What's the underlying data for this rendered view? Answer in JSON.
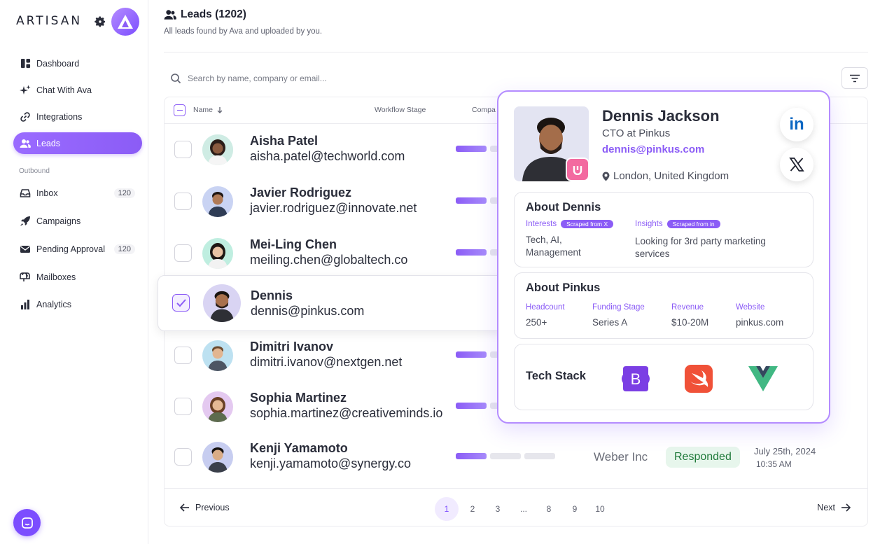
{
  "brand": {
    "name": "ARTISAN"
  },
  "sidebar": {
    "items": [
      {
        "label": "Dashboard",
        "icon": "dashboard-icon"
      },
      {
        "label": "Chat With Ava",
        "icon": "sparkle-icon"
      },
      {
        "label": "Integrations",
        "icon": "link-icon"
      },
      {
        "label": "Leads",
        "icon": "users-icon",
        "active": true
      }
    ],
    "section_label": "Outbound",
    "outbound_items": [
      {
        "label": "Inbox",
        "icon": "inbox-icon",
        "count": "120"
      },
      {
        "label": "Campaigns",
        "icon": "rocket-icon"
      },
      {
        "label": "Pending Approval",
        "icon": "mail-icon",
        "count": "120"
      },
      {
        "label": "Mailboxes",
        "icon": "mailbox-icon"
      },
      {
        "label": "Analytics",
        "icon": "bar-chart-icon"
      }
    ]
  },
  "header": {
    "title": "Leads (1202)",
    "subtitle": "All leads found by Ava and uploaded by you."
  },
  "search": {
    "placeholder": "Search by name, company or email..."
  },
  "table": {
    "columns": {
      "name": "Name",
      "stage": "Workflow Stage",
      "company": "Compa"
    },
    "rows": [
      {
        "name": "Aisha Patel",
        "email": "aisha.patel@techworld.com",
        "stage": 1,
        "checked": false
      },
      {
        "name": "Javier Rodriguez",
        "email": "javier.rodriguez@innovate.net",
        "stage": 1,
        "checked": false
      },
      {
        "name": "Mei-Ling Chen",
        "email": "meiling.chen@globaltech.co",
        "stage": 1,
        "checked": false
      },
      {
        "name": "Dennis",
        "email": "dennis@pinkus.com",
        "stage": 0,
        "checked": true
      },
      {
        "name": "Dimitri Ivanov",
        "email": "dimitri.ivanov@nextgen.net",
        "stage": 1,
        "checked": false
      },
      {
        "name": "Sophia Martinez",
        "email": "sophia.martinez@creativeminds.io",
        "stage": 1,
        "checked": false
      },
      {
        "name": "Kenji Yamamoto",
        "email": "kenji.yamamoto@synergy.co",
        "stage": 1,
        "checked": false,
        "company": "Weber Inc",
        "status": "Responded",
        "date": "July 25th, 2024",
        "time": "10:35 AM"
      }
    ]
  },
  "pagination": {
    "prev": "Previous",
    "next": "Next",
    "pages": [
      "1",
      "2",
      "3",
      "...",
      "8",
      "9",
      "10"
    ],
    "current": "1"
  },
  "profile": {
    "name": "Dennis Jackson",
    "role": "CTO at Pinkus",
    "email": "dennis@pinkus.com",
    "location": "London, United Kingdom",
    "about_title": "About Dennis",
    "interests_label": "Interests",
    "interests_badge": "Scraped from X",
    "interests_value": "Tech, AI, Management",
    "insights_label": "Insights",
    "insights_badge": "Scraped from in",
    "insights_value": "Looking for 3rd party marketing services",
    "company_title": "About Pinkus",
    "headcount_label": "Headcount",
    "headcount": "250+",
    "funding_label": "Funding Stage",
    "funding": "Series A",
    "revenue_label": "Revenue",
    "revenue": "$10-20M",
    "website_label": "Website",
    "website": "pinkus.com",
    "tech_title": "Tech Stack",
    "tech": [
      {
        "letter": "B",
        "icon": "bootstrap-icon"
      },
      {
        "icon": "swift-icon"
      },
      {
        "icon": "vue-icon"
      }
    ],
    "linkedin": "in"
  },
  "colors": {
    "accent": "#8b5cf6",
    "status_green": "#1f7a3a"
  }
}
